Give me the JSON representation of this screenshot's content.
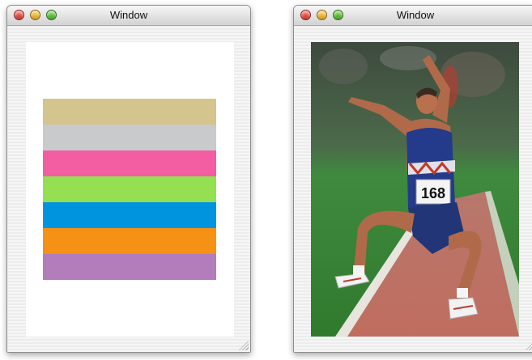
{
  "windows": [
    {
      "title": "Window",
      "content": "color-stripes",
      "stripe_colors": [
        "#d4c48e",
        "#c9cacc",
        "#f35ea2",
        "#94df52",
        "#0094de",
        "#f59114",
        "#b37cbb"
      ]
    },
    {
      "title": "Window",
      "content": "photo",
      "photo": {
        "subject": "long jumper mid-air",
        "bib_number": "168"
      }
    }
  ],
  "traffic_lights": {
    "close_color": "#e94b43",
    "minimize_color": "#f3b92e",
    "zoom_color": "#5cc139"
  }
}
